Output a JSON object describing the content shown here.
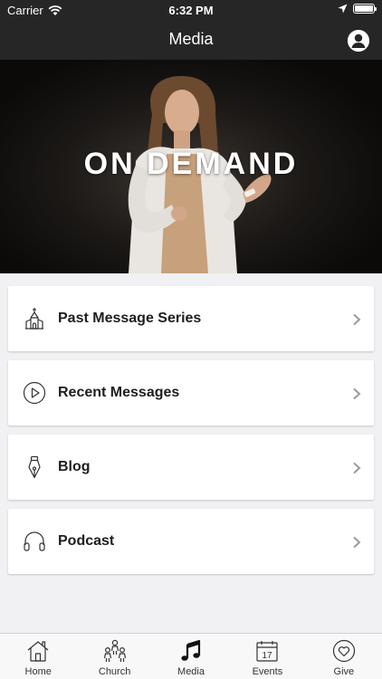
{
  "status_bar": {
    "carrier": "Carrier",
    "time": "6:32 PM"
  },
  "nav_bar": {
    "title": "Media",
    "profile_icon": "person-circle-icon"
  },
  "hero": {
    "title": "ON DEMAND"
  },
  "menu": {
    "items": [
      {
        "label": "Past Message Series",
        "icon": "church-icon"
      },
      {
        "label": "Recent Messages",
        "icon": "play-circle-icon"
      },
      {
        "label": "Blog",
        "icon": "pen-nib-icon"
      },
      {
        "label": "Podcast",
        "icon": "headphones-icon"
      }
    ]
  },
  "tab_bar": {
    "tabs": [
      {
        "label": "Home",
        "icon": "house-icon"
      },
      {
        "label": "Church",
        "icon": "people-icon"
      },
      {
        "label": "Media",
        "icon": "music-note-icon"
      },
      {
        "label": "Events",
        "icon": "calendar-icon",
        "calendar_day": "17"
      },
      {
        "label": "Give",
        "icon": "heart-circle-icon"
      }
    ]
  },
  "colors": {
    "bar_dark": "#262626",
    "background": "#f1f1f3",
    "card": "#ffffff",
    "text": "#1e1e1e"
  }
}
